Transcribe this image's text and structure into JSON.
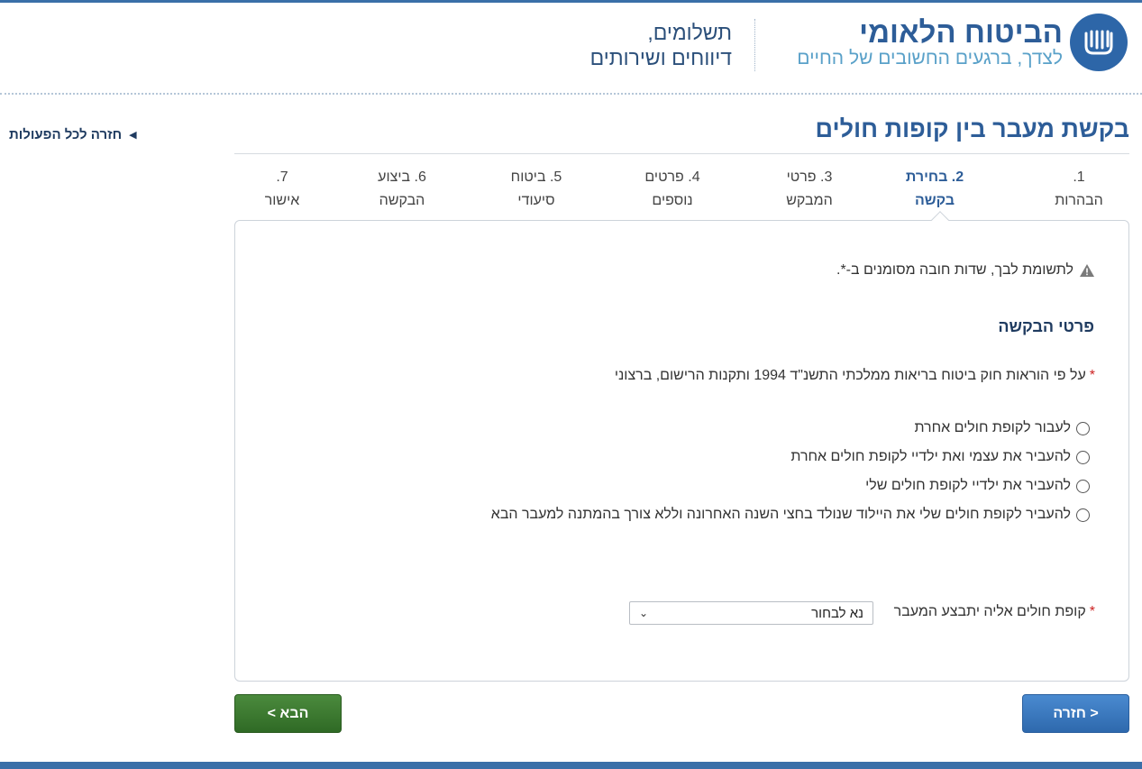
{
  "header": {
    "brand_title": "הביטוח הלאומי",
    "brand_tagline": "לצדך, ברגעים החשובים של החיים",
    "link_line1": "תשלומים,",
    "link_line2": "דיווחים ושירותים",
    "logo_icon": "national-insurance-logo-icon"
  },
  "nav": {
    "back_to_all": "חזרה לכל הפעולות"
  },
  "page": {
    "title": "בקשת מעבר בין קופות חולים"
  },
  "steps": [
    {
      "line1": "1.",
      "line2": "הבהרות",
      "active": false
    },
    {
      "line1": "2. בחירת",
      "line2": "בקשה",
      "active": true
    },
    {
      "line1": "3. פרטי",
      "line2": "המבקש",
      "active": false
    },
    {
      "line1": "4. פרטים",
      "line2": "נוספים",
      "active": false
    },
    {
      "line1": "5. ביטוח",
      "line2": "סיעודי",
      "active": false
    },
    {
      "line1": "6. ביצוע",
      "line2": "הבקשה",
      "active": false
    },
    {
      "line1": "7.",
      "line2": "אישור",
      "active": false
    }
  ],
  "form": {
    "notice": "לתשומת לבך, שדות חובה מסומנים ב-*.",
    "section_title": "פרטי הבקשה",
    "required_mark": "*",
    "law_text": "על פי הוראות חוק ביטוח בריאות ממלכתי התשנ\"ד 1994 ותקנות הרישום, ברצוני",
    "options": [
      "לעבור לקופת חולים אחרת",
      "להעביר את עצמי ואת ילדיי לקופת חולים אחרת",
      "להעביר את ילדיי לקופת חולים שלי",
      "להעביר לקופת חולים שלי את היילוד שנולד בחצי השנה האחרונה וללא צורך בהמתנה למעבר הבא"
    ],
    "select_label": "קופת חולים אליה יתבצע המעבר",
    "select_value": "נא לבחור"
  },
  "buttons": {
    "next": "הבא >",
    "back": "< חזרה"
  },
  "colors": {
    "brand_blue": "#2d5d98",
    "next_green": "#3a7a30",
    "back_blue": "#3a7abf",
    "required_red": "#cc2222"
  }
}
